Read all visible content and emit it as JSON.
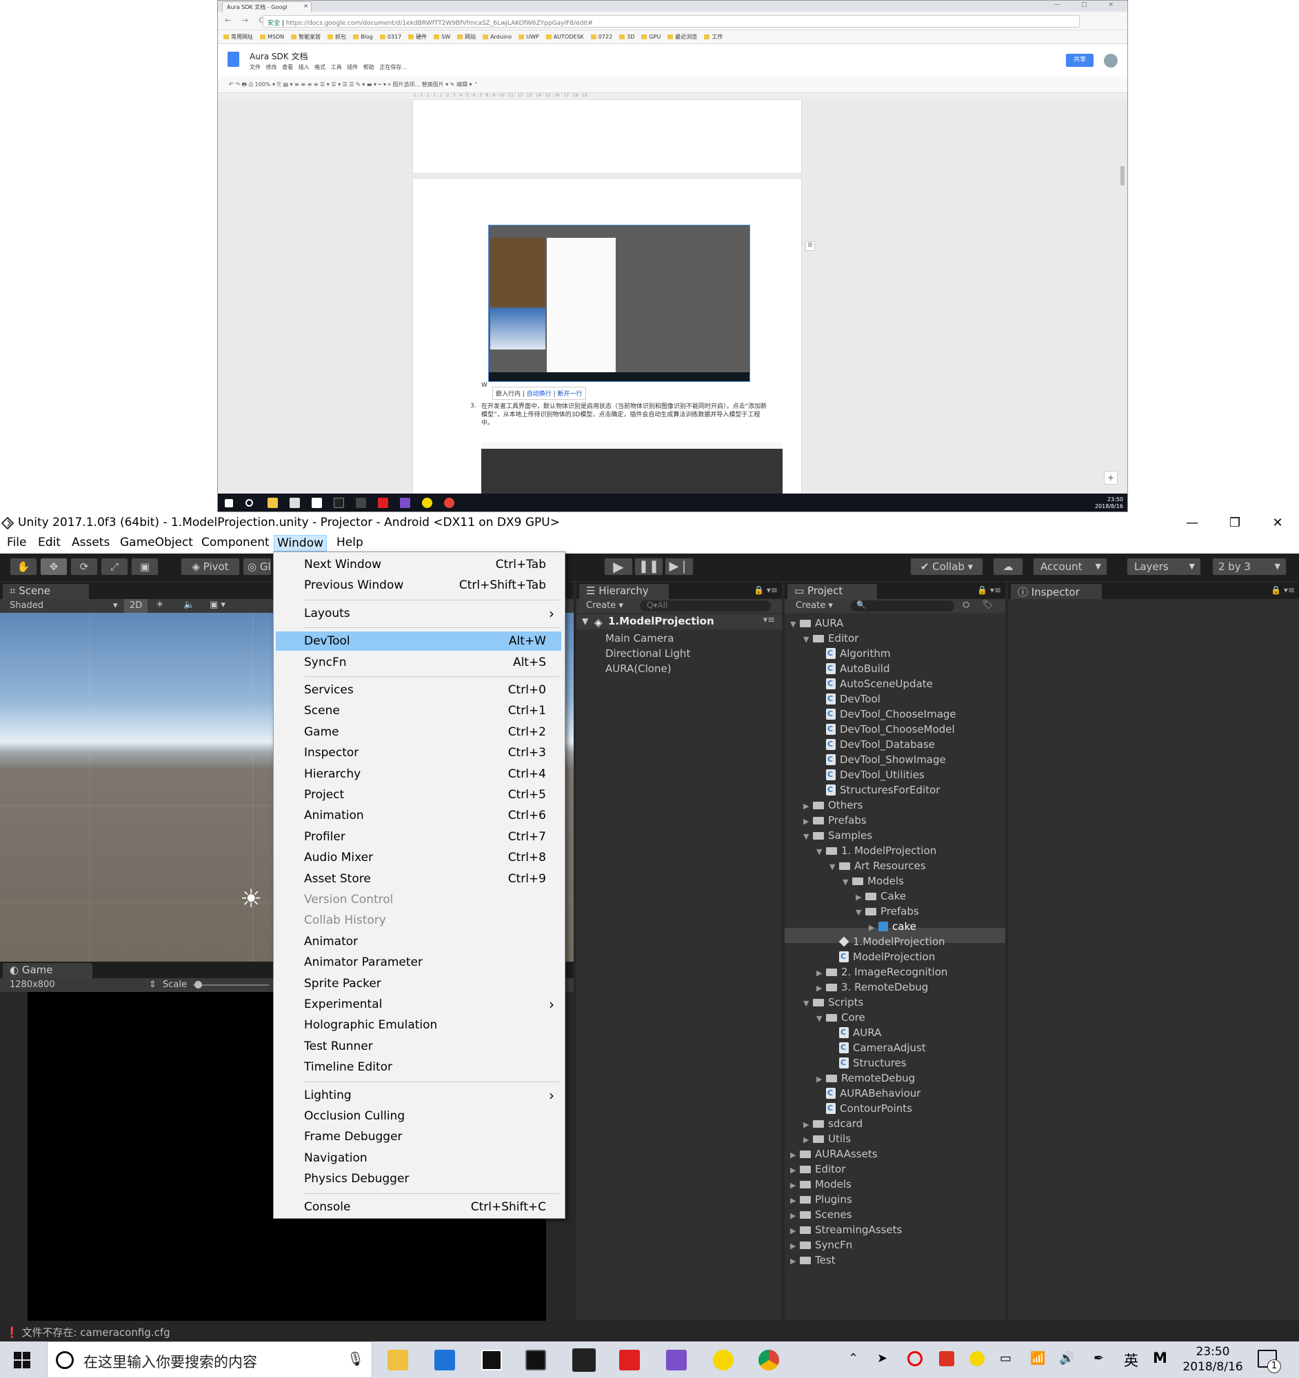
{
  "browser": {
    "tab_title": "Aura SDK 文档 - Googl",
    "tab_close": "×",
    "window_buttons": "— □ ×",
    "nav": "← → C",
    "secure_label": "安全",
    "url": "https://docs.google.com/document/d/1ekdBRWfTT2W9BfVfmcaSZ_6LwjLAKOfW6ZYppGayIF8/edit#",
    "bookmarks": [
      "常用网址",
      "MSDN",
      "智能家居",
      "抓包",
      "Blog",
      "0317",
      "硬件",
      "SW",
      "网站",
      "Arduino",
      "UWP",
      "AUTODESK",
      "0722",
      "3D",
      "GPU",
      "最近浏览",
      "工作"
    ]
  },
  "gdocs": {
    "title": "Aura SDK 文档",
    "menu": "文件 修改 查看 插入 格式 工具 插件 帮助 正在保存…",
    "share": "共享",
    "toolbar": "↶ ↷ 🖶 ⎙   100% ▾   ⎘ ▤ ▾   ≡ ≡ ≡ ≡   ☰ ▾ ☰ ▾ ☰ ☰   ✎ ▾ ▬ ▾ ┅ ▾   ⌗  图片选项...  替换图片 ▾                                                                                                       ✎ 编辑 ▾  ⌃",
    "ruler": "· 1 · 2 · 1 · 1 · 1 · 2 · 3 · 4 · 5 · 6 · 7 · 8 · 9 · 10 · 11 · 12 · 13 · 14 · 15 · 16 · 17 · 18 · 19",
    "caption_a": "嵌入行内 | ",
    "caption_b": "自动换行",
    "caption_c": " | ",
    "caption_d": "断开一行",
    "text_num": "3.",
    "text": "在开发者工具界面中，默认物体识别是启用状态（当前物体识别和图像识别不能同时开启），点击“添加新模型”，从本地上传待识别物体的3D模型，点击确定，插件会自动生成算法训练数据并导入模型于工程中。",
    "stub": "W"
  },
  "small_taskbar": {
    "time": "23:50",
    "date": "2018/8/16"
  },
  "unity": {
    "title": "Unity 2017.1.0f3 (64bit) - 1.ModelProjection.unity - Projector - Android <DX11 on DX9 GPU>",
    "window_buttons": [
      "—",
      "❐",
      "✕"
    ],
    "menus": [
      "File",
      "Edit",
      "Assets",
      "GameObject",
      "Component",
      "Window",
      "Help"
    ],
    "toolbar": {
      "pivot": "Pivot",
      "global": "Gl",
      "collab": "✔ Collab ▾",
      "cloud": "☁",
      "account": "Account",
      "layers": "Layers",
      "layout": "2 by 3"
    },
    "scene": {
      "tab": "Scene",
      "shading": "Shaded",
      "mode_2d": "2D"
    },
    "game": {
      "tab": "Game",
      "resolution": "1280x800",
      "scale": "Scale"
    },
    "hierarchy": {
      "tab": "Hierarchy",
      "create": "Create ▾",
      "search": "Q▾All",
      "scene": "1.ModelProjection",
      "items": [
        "Main Camera",
        "Directional Light",
        "AURA(Clone)"
      ]
    },
    "project": {
      "tab": "Project",
      "create": "Create ▾",
      "tree": [
        {
          "label": "AURA",
          "lvl": 0,
          "t": "fold",
          "a": "▼"
        },
        {
          "label": "Editor",
          "lvl": 1,
          "t": "fold",
          "a": "▼"
        },
        {
          "label": "Algorithm",
          "lvl": 2,
          "t": "scr",
          "a": ""
        },
        {
          "label": "AutoBuild",
          "lvl": 2,
          "t": "scr",
          "a": ""
        },
        {
          "label": "AutoSceneUpdate",
          "lvl": 2,
          "t": "scr",
          "a": ""
        },
        {
          "label": "DevTool",
          "lvl": 2,
          "t": "scr",
          "a": ""
        },
        {
          "label": "DevTool_ChooseImage",
          "lvl": 2,
          "t": "scr",
          "a": ""
        },
        {
          "label": "DevTool_ChooseModel",
          "lvl": 2,
          "t": "scr",
          "a": ""
        },
        {
          "label": "DevTool_Database",
          "lvl": 2,
          "t": "scr",
          "a": ""
        },
        {
          "label": "DevTool_ShowImage",
          "lvl": 2,
          "t": "scr",
          "a": ""
        },
        {
          "label": "DevTool_Utilities",
          "lvl": 2,
          "t": "scr",
          "a": ""
        },
        {
          "label": "StructuresForEditor",
          "lvl": 2,
          "t": "scr",
          "a": ""
        },
        {
          "label": "Others",
          "lvl": 1,
          "t": "fold",
          "a": "▶"
        },
        {
          "label": "Prefabs",
          "lvl": 1,
          "t": "fold",
          "a": "▶"
        },
        {
          "label": "Samples",
          "lvl": 1,
          "t": "fold",
          "a": "▼"
        },
        {
          "label": "1. ModelProjection",
          "lvl": 2,
          "t": "fold",
          "a": "▼"
        },
        {
          "label": "Art Resources",
          "lvl": 3,
          "t": "fold",
          "a": "▼"
        },
        {
          "label": "Models",
          "lvl": 4,
          "t": "fold",
          "a": "▼"
        },
        {
          "label": "Cake",
          "lvl": 5,
          "t": "fold",
          "a": "▶"
        },
        {
          "label": "Prefabs",
          "lvl": 5,
          "t": "fold",
          "a": "▼"
        },
        {
          "label": "cake",
          "lvl": 6,
          "t": "cube",
          "a": "▶",
          "sel": true
        },
        {
          "label": "1.ModelProjection",
          "lvl": 3,
          "t": "uni",
          "a": ""
        },
        {
          "label": "ModelProjection",
          "lvl": 3,
          "t": "scr",
          "a": ""
        },
        {
          "label": "2. ImageRecognition",
          "lvl": 2,
          "t": "fold",
          "a": "▶"
        },
        {
          "label": "3. RemoteDebug",
          "lvl": 2,
          "t": "fold",
          "a": "▶"
        },
        {
          "label": "Scripts",
          "lvl": 1,
          "t": "fold",
          "a": "▼"
        },
        {
          "label": "Core",
          "lvl": 2,
          "t": "fold",
          "a": "▼"
        },
        {
          "label": "AURA",
          "lvl": 3,
          "t": "scr",
          "a": ""
        },
        {
          "label": "CameraAdjust",
          "lvl": 3,
          "t": "scr",
          "a": ""
        },
        {
          "label": "Structures",
          "lvl": 3,
          "t": "scr",
          "a": ""
        },
        {
          "label": "RemoteDebug",
          "lvl": 2,
          "t": "fold",
          "a": "▶"
        },
        {
          "label": "AURABehaviour",
          "lvl": 2,
          "t": "scr",
          "a": ""
        },
        {
          "label": "ContourPoints",
          "lvl": 2,
          "t": "scr",
          "a": ""
        },
        {
          "label": "sdcard",
          "lvl": 1,
          "t": "fold",
          "a": "▶"
        },
        {
          "label": "Utils",
          "lvl": 1,
          "t": "fold",
          "a": "▶"
        },
        {
          "label": "AURAAssets",
          "lvl": 0,
          "t": "fold",
          "a": "▶"
        },
        {
          "label": "Editor",
          "lvl": 0,
          "t": "fold",
          "a": "▶"
        },
        {
          "label": "Models",
          "lvl": 0,
          "t": "fold",
          "a": "▶"
        },
        {
          "label": "Plugins",
          "lvl": 0,
          "t": "fold",
          "a": "▶"
        },
        {
          "label": "Scenes",
          "lvl": 0,
          "t": "fold",
          "a": "▶"
        },
        {
          "label": "StreamingAssets",
          "lvl": 0,
          "t": "fold",
          "a": "▶"
        },
        {
          "label": "SyncFn",
          "lvl": 0,
          "t": "fold",
          "a": "▶"
        },
        {
          "label": "Test",
          "lvl": 0,
          "t": "fold",
          "a": "▶"
        }
      ]
    },
    "inspector": {
      "tab": "Inspector"
    },
    "status": "文件不存在: cameraconfig.cfg",
    "window_menu": [
      {
        "label": "Next Window",
        "shortcut": "Ctrl+Tab"
      },
      {
        "label": "Previous Window",
        "shortcut": "Ctrl+Shift+Tab"
      },
      {
        "sep": true
      },
      {
        "label": "Layouts",
        "shortcut": "",
        "sub": true
      },
      {
        "sep": true
      },
      {
        "label": "DevTool",
        "shortcut": "Alt+W",
        "hi": true
      },
      {
        "label": "SyncFn",
        "shortcut": "Alt+S"
      },
      {
        "sep": true
      },
      {
        "label": "Services",
        "shortcut": "Ctrl+0"
      },
      {
        "label": "Scene",
        "shortcut": "Ctrl+1"
      },
      {
        "label": "Game",
        "shortcut": "Ctrl+2"
      },
      {
        "label": "Inspector",
        "shortcut": "Ctrl+3"
      },
      {
        "label": "Hierarchy",
        "shortcut": "Ctrl+4"
      },
      {
        "label": "Project",
        "shortcut": "Ctrl+5"
      },
      {
        "label": "Animation",
        "shortcut": "Ctrl+6"
      },
      {
        "label": "Profiler",
        "shortcut": "Ctrl+7"
      },
      {
        "label": "Audio Mixer",
        "shortcut": "Ctrl+8"
      },
      {
        "label": "Asset Store",
        "shortcut": "Ctrl+9"
      },
      {
        "label": "Version Control",
        "shortcut": "",
        "disabled": true
      },
      {
        "label": "Collab History",
        "shortcut": "",
        "disabled": true
      },
      {
        "label": "Animator",
        "shortcut": ""
      },
      {
        "label": "Animator Parameter",
        "shortcut": ""
      },
      {
        "label": "Sprite Packer",
        "shortcut": ""
      },
      {
        "label": "Experimental",
        "shortcut": "",
        "sub": true
      },
      {
        "label": "Holographic Emulation",
        "shortcut": ""
      },
      {
        "label": "Test Runner",
        "shortcut": ""
      },
      {
        "label": "Timeline Editor",
        "shortcut": ""
      },
      {
        "sep": true
      },
      {
        "label": "Lighting",
        "shortcut": "",
        "sub": true
      },
      {
        "label": "Occlusion Culling",
        "shortcut": ""
      },
      {
        "label": "Frame Debugger",
        "shortcut": ""
      },
      {
        "label": "Navigation",
        "shortcut": ""
      },
      {
        "label": "Physics Debugger",
        "shortcut": ""
      },
      {
        "sep": true
      },
      {
        "label": "Console",
        "shortcut": "Ctrl+Shift+C"
      }
    ]
  },
  "taskbar": {
    "search_placeholder": "在这里输入你要搜索的内容",
    "ime": "英",
    "time": "23:50",
    "date": "2018/8/16",
    "notify_count": "1"
  }
}
